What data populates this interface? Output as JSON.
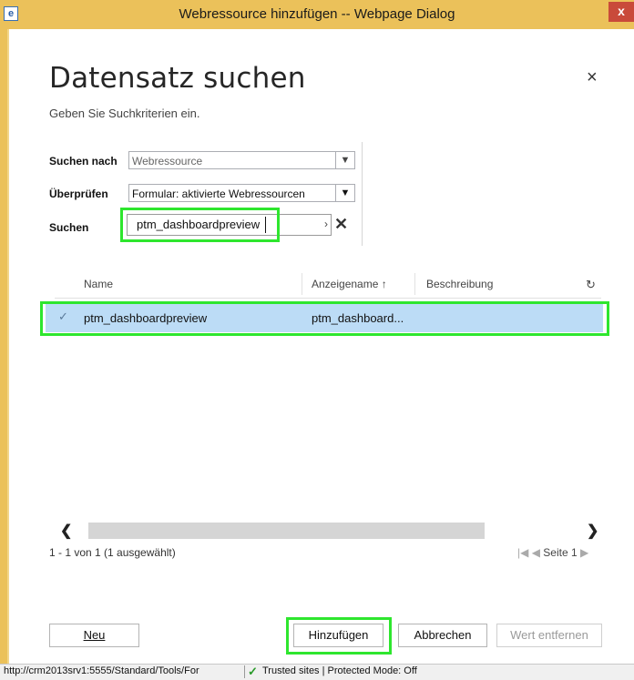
{
  "window": {
    "title": "Webressource hinzufügen -- Webpage Dialog",
    "close_glyph": "x"
  },
  "dialog": {
    "heading": "Datensatz suchen",
    "subtitle": "Geben Sie Suchkriterien ein.",
    "close_glyph": "×"
  },
  "form": {
    "search_for_label": "Suchen nach",
    "search_for_value": "Webressource",
    "check_label": "Überprüfen",
    "check_value": "Formular: aktivierte Webressourcen",
    "search_label": "Suchen",
    "search_value": "ptm_dashboardpreview",
    "search_more_glyph": "›",
    "search_clear_glyph": "✕"
  },
  "grid": {
    "columns": [
      "Name",
      "Anzeigename ↑",
      "Beschreibung"
    ],
    "rows": [
      {
        "name": "ptm_dashboardpreview",
        "display_name": "ptm_dashboard...",
        "description": "",
        "selected": true
      }
    ],
    "refresh_icon": "refresh-icon",
    "pager_text": "1 - 1 von 1 (1 ausgewählt)",
    "page_label": "Seite 1"
  },
  "buttons": {
    "new_label": "Neu",
    "add_label": "Hinzufügen",
    "cancel_label": "Abbrechen",
    "remove_label": "Wert entfernen"
  },
  "statusbar": {
    "url": "http://crm2013srv1:5555/Standard/Tools/For",
    "zone": "Trusted sites | Protected Mode: Off"
  },
  "colors": {
    "titlebar": "#ebc15a",
    "highlight": "#2ee62e",
    "selected_row": "#bcdcf6"
  }
}
